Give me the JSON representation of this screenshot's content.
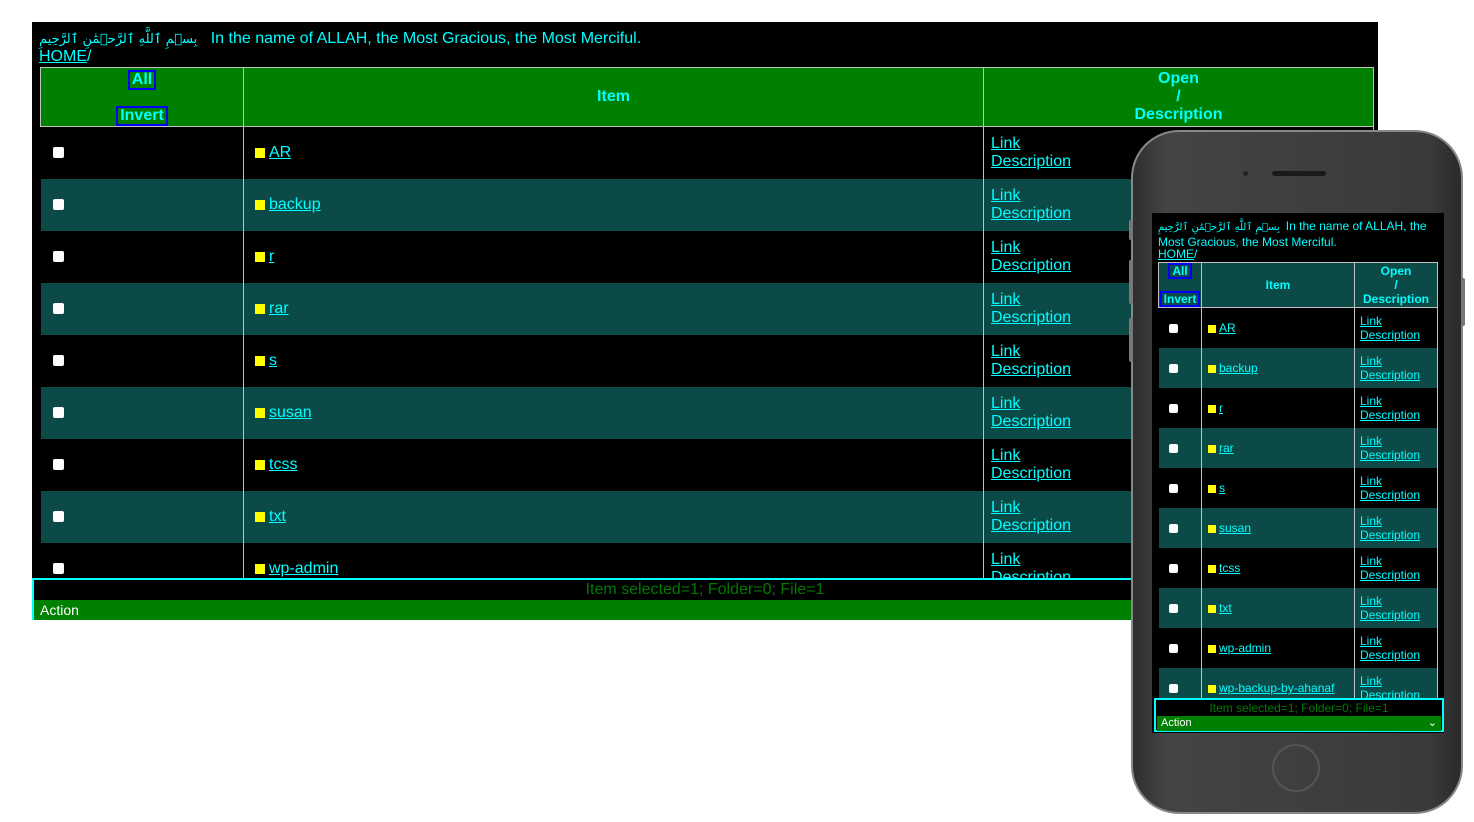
{
  "header": {
    "arabic": "بِسۡمِ ٱللَّهِ ٱلرَّحۡمَٰنِ ٱلرَّحِيمِ",
    "text": "In the name of ALLAH, the Most Gracious, the Most Merciful.",
    "home_link": "HOME",
    "separator": "/"
  },
  "table": {
    "select_all": "All",
    "invert": "Invert",
    "col_item": "Item",
    "col_open_1": "Open",
    "col_open_2": "/",
    "col_open_3": "Description",
    "link_label": "Link",
    "description_label": "Description",
    "rows": [
      "AR",
      "backup",
      "r",
      "rar",
      "s",
      "susan",
      "tcss",
      "txt",
      "wp-admin",
      "wp-backup-by-ahanaf"
    ]
  },
  "status": {
    "text": "Item selected=1; Folder=0; File=1",
    "action_label": "Action"
  },
  "colors": {
    "text_accent": "#00ffff",
    "header_green": "#008000",
    "row_alt": "#0c4a48",
    "folder_square": "#ffff00"
  }
}
